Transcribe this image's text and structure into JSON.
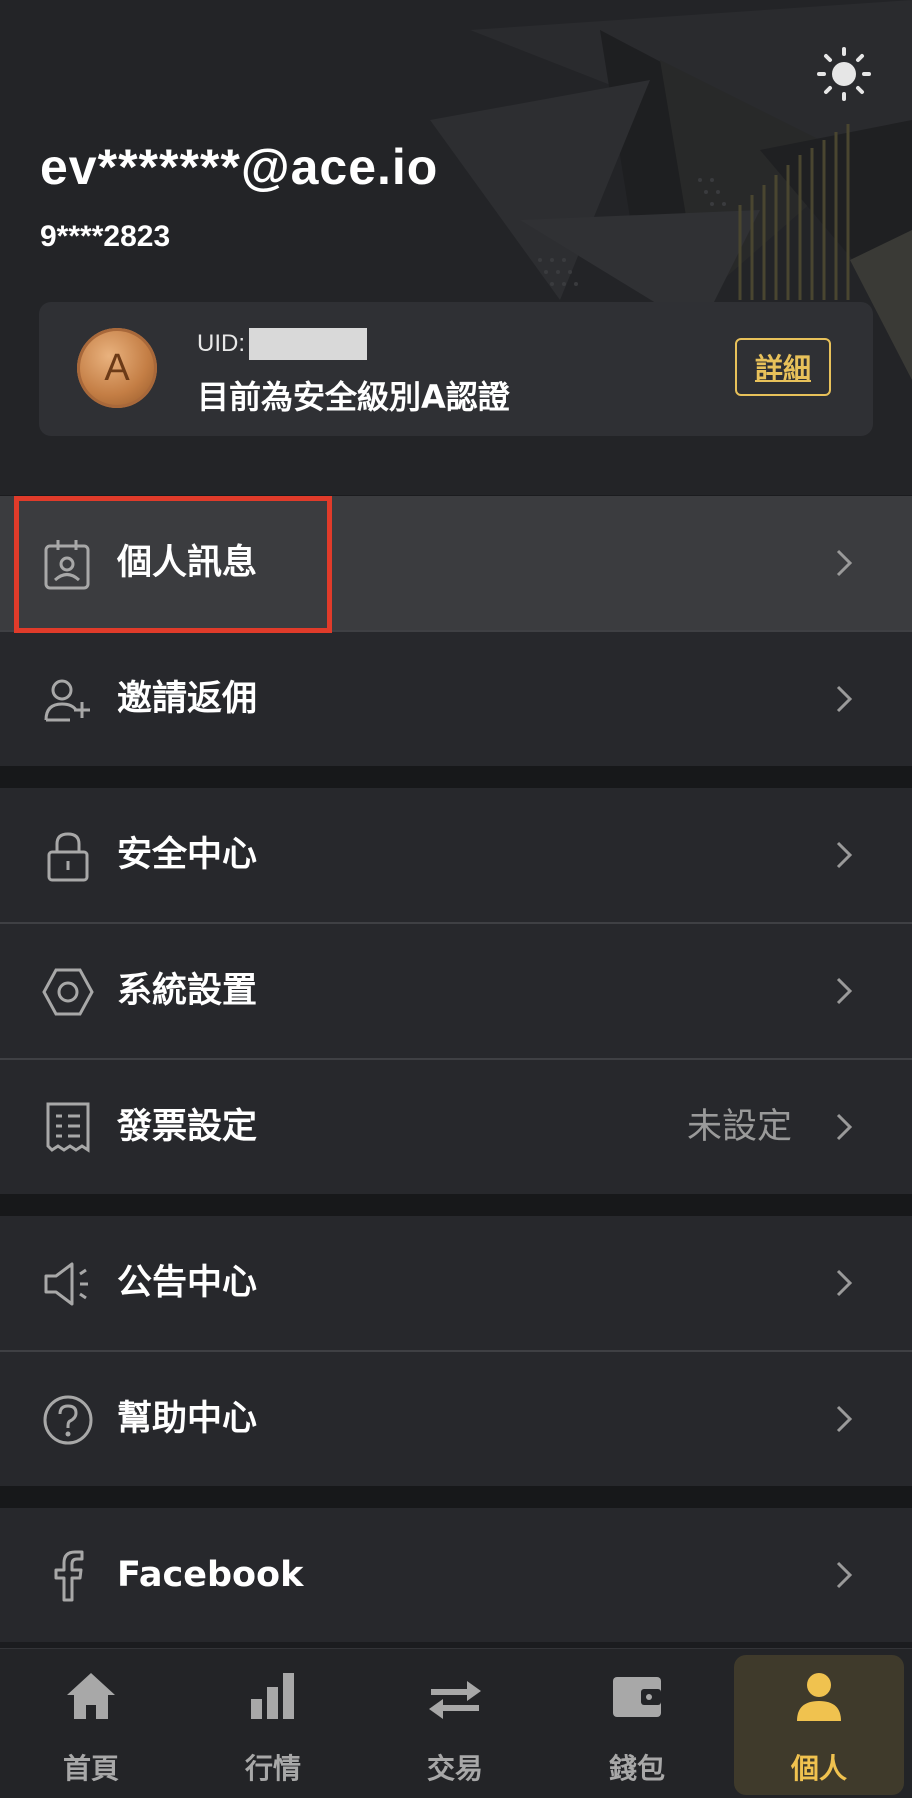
{
  "header": {
    "email": "ev*******@ace.io",
    "phone": "9****2823",
    "theme_icon": "sun-icon"
  },
  "account_card": {
    "badge_letter": "A",
    "uid_label": "UID:",
    "security_level_text": "目前為安全級別A認證",
    "details_label": "詳細",
    "badge_color": "#c47e45",
    "accent_color": "#e8c15a"
  },
  "menu": {
    "personal_info": {
      "label": "個人訊息",
      "icon": "id-badge-icon"
    },
    "invite": {
      "label": "邀請返佣",
      "icon": "user-plus-icon"
    },
    "security": {
      "label": "安全中心",
      "icon": "lock-icon"
    },
    "settings": {
      "label": "系統設置",
      "icon": "hexagon-gear-icon"
    },
    "invoice": {
      "label": "發票設定",
      "value": "未設定",
      "icon": "receipt-icon"
    },
    "announcements": {
      "label": "公告中心",
      "icon": "megaphone-icon"
    },
    "help": {
      "label": "幫助中心",
      "icon": "question-circle-icon"
    },
    "facebook": {
      "label": "Facebook",
      "icon": "facebook-icon"
    }
  },
  "tabbar": {
    "tabs": [
      {
        "label": "首頁",
        "icon": "home-icon"
      },
      {
        "label": "行情",
        "icon": "bar-chart-icon"
      },
      {
        "label": "交易",
        "icon": "swap-arrows-icon"
      },
      {
        "label": "錢包",
        "icon": "wallet-icon"
      },
      {
        "label": "個人",
        "icon": "person-icon"
      }
    ],
    "active_color": "#f0c24f"
  }
}
